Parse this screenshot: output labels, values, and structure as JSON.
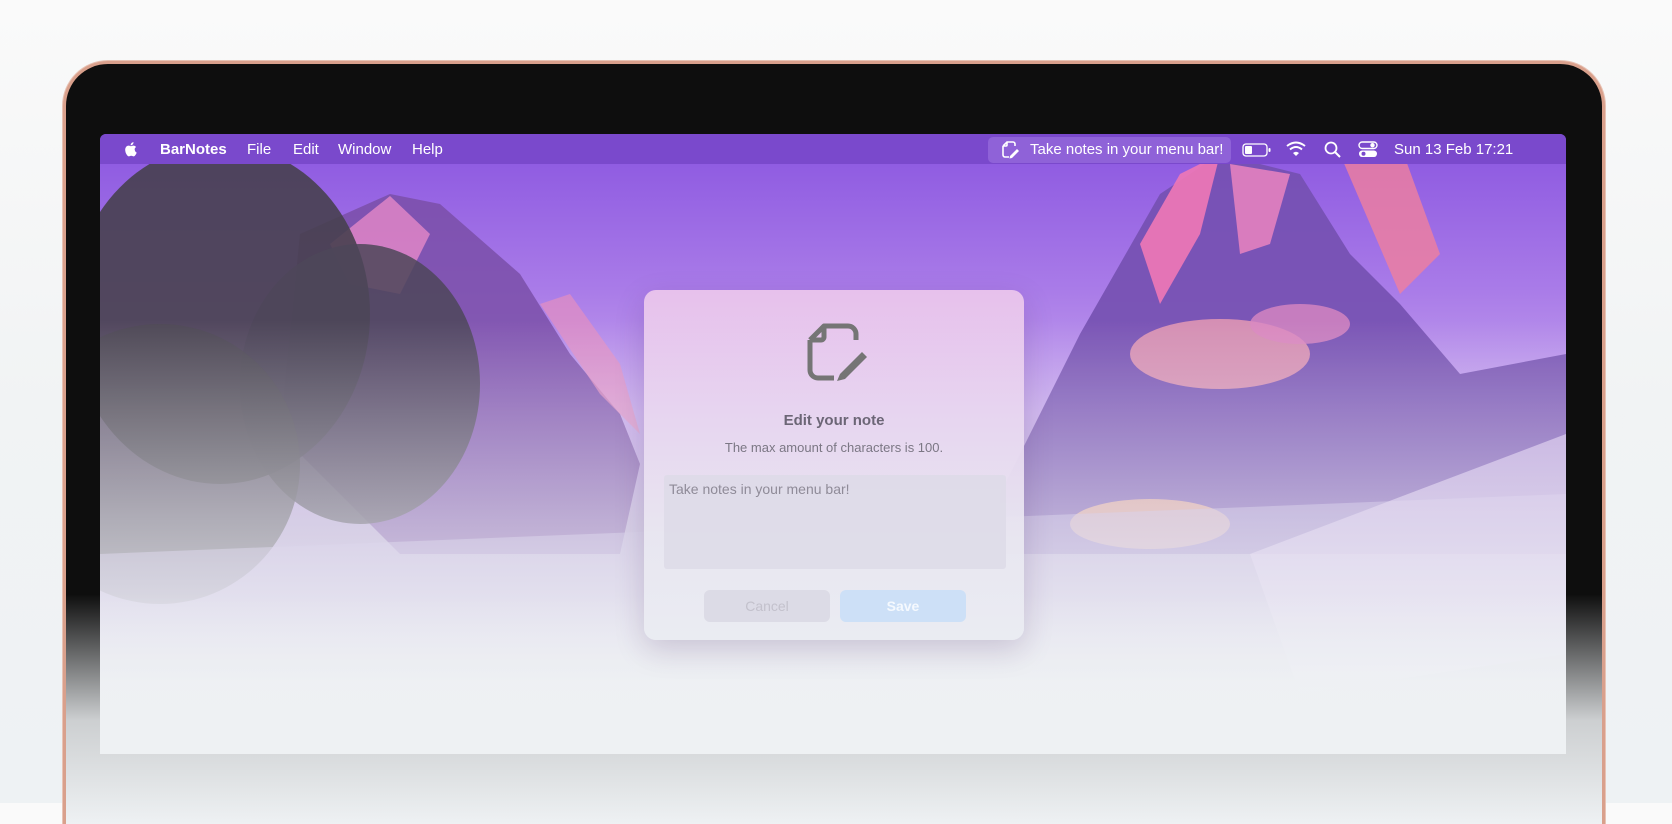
{
  "menubar": {
    "app_name": "BarNotes",
    "menus": [
      "File",
      "Edit",
      "Window",
      "Help"
    ],
    "note_item": "Take notes in your menu bar!",
    "datetime": "Sun 13 Feb  17:21",
    "icons": [
      "apple-icon",
      "note-edit-icon",
      "battery-icon",
      "wifi-icon",
      "search-icon",
      "control-center-icon"
    ]
  },
  "dialog": {
    "title": "Edit your note",
    "subtitle": "The max amount of characters is 100.",
    "input_value": "Take notes in your menu bar!",
    "cancel_label": "Cancel",
    "save_label": "Save"
  },
  "colors": {
    "menubar": "#7a49cc",
    "accent_save": "#cde0f7",
    "laptop_bezel": "#0e0e0e",
    "laptop_rim": "#d9a08c"
  }
}
